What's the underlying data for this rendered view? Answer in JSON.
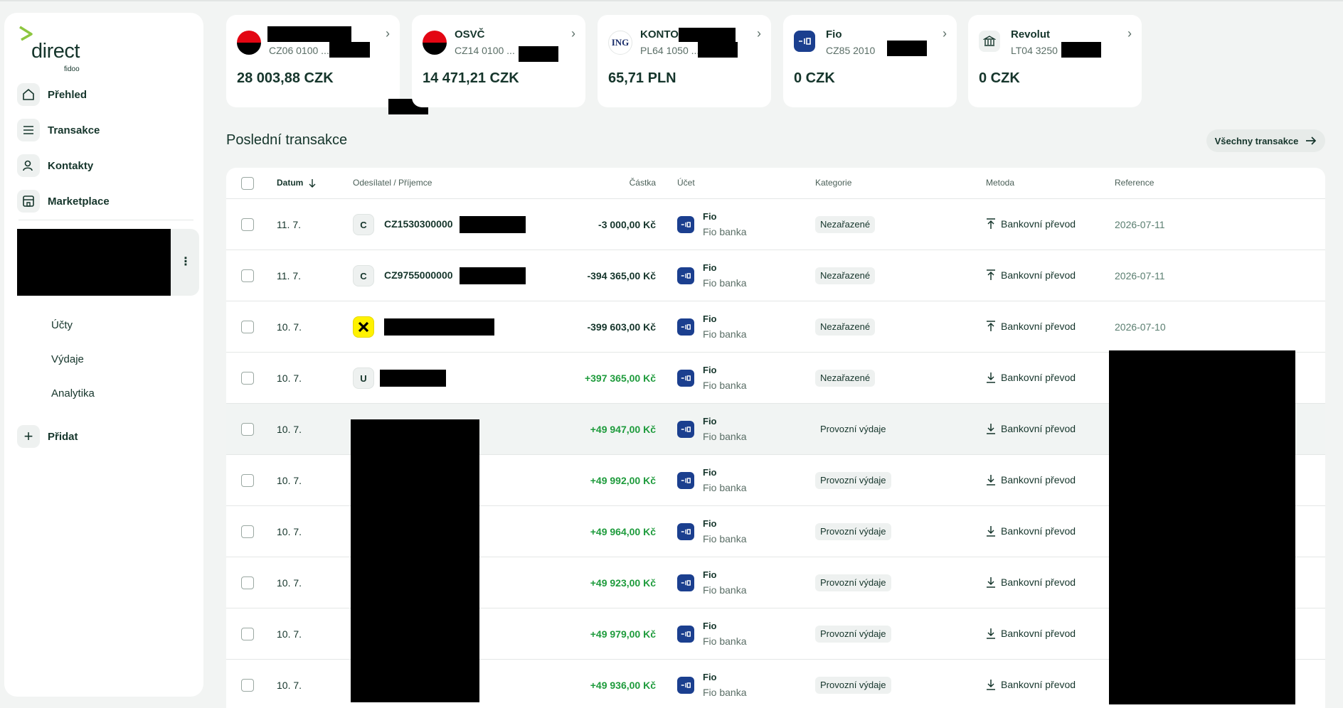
{
  "brand": {
    "name": "direct",
    "sub": "fidoo",
    "accent": "#8dc63f"
  },
  "nav": [
    {
      "label": "Přehled",
      "icon": "home-icon"
    },
    {
      "label": "Transakce",
      "icon": "list-icon"
    },
    {
      "label": "Kontakty",
      "icon": "contacts-icon"
    },
    {
      "label": "Marketplace",
      "icon": "store-icon"
    }
  ],
  "sub_nav": [
    {
      "label": "Účty"
    },
    {
      "label": "Výdaje"
    },
    {
      "label": "Analytika"
    }
  ],
  "add_label": "Přidat",
  "accounts": [
    {
      "name": "",
      "iban": "CZ06 0100 ...",
      "balance": "28 003,88 CZK",
      "logo": "kb"
    },
    {
      "name": "OSVČ",
      "iban": "CZ14 0100 ...",
      "balance": "14 471,21 CZK",
      "logo": "kb"
    },
    {
      "name": "KONTO",
      "iban": "PL64 1050 ...",
      "balance": "65,71 PLN",
      "logo": "ing"
    },
    {
      "name": "Fio",
      "iban": "CZ85 2010",
      "balance": "0 CZK",
      "logo": "fio"
    },
    {
      "name": "Revolut",
      "iban": "LT04 3250",
      "balance": "0 CZK",
      "logo": "bank"
    }
  ],
  "section_title": "Poslední transakce",
  "all_button": "Všechny transakce",
  "table": {
    "headers": {
      "date": "Datum",
      "party": "Odesílatel / Příjemce",
      "amount": "Částka",
      "account": "Účet",
      "category": "Kategorie",
      "method": "Metoda",
      "reference": "Reference"
    },
    "rows": [
      {
        "date": "11. 7.",
        "avatar": "C",
        "party": "CZ1530300000",
        "amount": "-3 000,00 Kč",
        "sign": "neg",
        "acc": "Fio",
        "bank": "Fio banka",
        "category": "Nezařazené",
        "method": "Bankovní převod",
        "dir": "out",
        "ref": "2026-07-11"
      },
      {
        "date": "11. 7.",
        "avatar": "C",
        "party": "CZ9755000000",
        "amount": "-394 365,00 Kč",
        "sign": "neg",
        "acc": "Fio",
        "bank": "Fio banka",
        "category": "Nezařazené",
        "method": "Bankovní převod",
        "dir": "out",
        "ref": "2026-07-11"
      },
      {
        "date": "10. 7.",
        "avatar": "raiffeisen",
        "party": "",
        "amount": "-399 603,00 Kč",
        "sign": "neg",
        "acc": "Fio",
        "bank": "Fio banka",
        "category": "Nezařazené",
        "method": "Bankovní převod",
        "dir": "out",
        "ref": "2026-07-10"
      },
      {
        "date": "10. 7.",
        "avatar": "U",
        "party": "",
        "amount": "+397 365,00 Kč",
        "sign": "pos",
        "acc": "Fio",
        "bank": "Fio banka",
        "category": "Nezařazené",
        "method": "Bankovní převod",
        "dir": "in",
        "ref": ""
      },
      {
        "date": "10. 7.",
        "avatar": "",
        "party": "",
        "amount": "+49 947,00 Kč",
        "sign": "pos",
        "acc": "Fio",
        "bank": "Fio banka",
        "category": "Provozní výdaje",
        "method": "Bankovní převod",
        "dir": "in",
        "ref": ""
      },
      {
        "date": "10. 7.",
        "avatar": "",
        "party": "",
        "amount": "+49 992,00 Kč",
        "sign": "pos",
        "acc": "Fio",
        "bank": "Fio banka",
        "category": "Provozní výdaje",
        "method": "Bankovní převod",
        "dir": "in",
        "ref": ""
      },
      {
        "date": "10. 7.",
        "avatar": "",
        "party": "",
        "amount": "+49 964,00 Kč",
        "sign": "pos",
        "acc": "Fio",
        "bank": "Fio banka",
        "category": "Provozní výdaje",
        "method": "Bankovní převod",
        "dir": "in",
        "ref": ""
      },
      {
        "date": "10. 7.",
        "avatar": "",
        "party": "",
        "amount": "+49 923,00 Kč",
        "sign": "pos",
        "acc": "Fio",
        "bank": "Fio banka",
        "category": "Provozní výdaje",
        "method": "Bankovní převod",
        "dir": "in",
        "ref": ""
      },
      {
        "date": "10. 7.",
        "avatar": "",
        "party": "",
        "amount": "+49 979,00 Kč",
        "sign": "pos",
        "acc": "Fio",
        "bank": "Fio banka",
        "category": "Provozní výdaje",
        "method": "Bankovní převod",
        "dir": "in",
        "ref": ""
      },
      {
        "date": "10. 7.",
        "avatar": "",
        "party": "",
        "amount": "+49 936,00 Kč",
        "sign": "pos",
        "acc": "Fio",
        "bank": "Fio banka",
        "category": "Provozní výdaje",
        "method": "Bankovní převod",
        "dir": "in",
        "ref": ""
      }
    ]
  }
}
